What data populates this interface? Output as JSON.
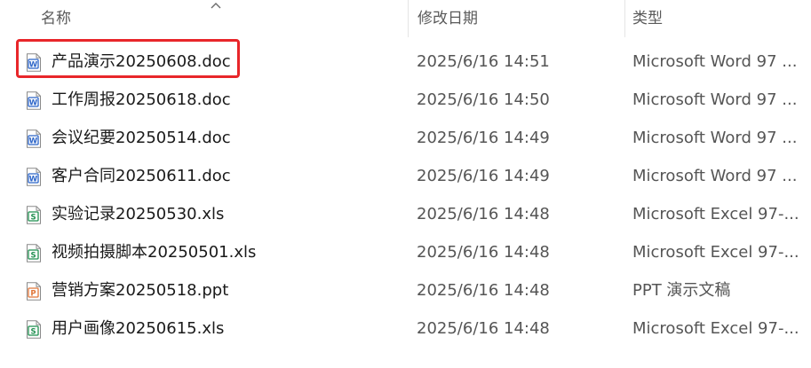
{
  "columns": {
    "name": "名称",
    "date": "修改日期",
    "type": "类型"
  },
  "files": [
    {
      "name": "产品演示20250608.doc",
      "date": "2025/6/16 14:51",
      "type": "Microsoft Word 97 ...",
      "icon": "word-doc-icon"
    },
    {
      "name": "工作周报20250618.doc",
      "date": "2025/6/16 14:50",
      "type": "Microsoft Word 97 ...",
      "icon": "word-doc-icon"
    },
    {
      "name": "会议纪要20250514.doc",
      "date": "2025/6/16 14:49",
      "type": "Microsoft Word 97 ...",
      "icon": "word-doc-icon"
    },
    {
      "name": "客户合同20250611.doc",
      "date": "2025/6/16 14:49",
      "type": "Microsoft Word 97 ...",
      "icon": "word-doc-icon"
    },
    {
      "name": "实验记录20250530.xls",
      "date": "2025/6/16 14:48",
      "type": "Microsoft Excel 97-...",
      "icon": "excel-sheet-icon"
    },
    {
      "name": "视频拍摄脚本20250501.xls",
      "date": "2025/6/16 14:48",
      "type": "Microsoft Excel 97-...",
      "icon": "excel-sheet-icon"
    },
    {
      "name": "营销方案20250518.ppt",
      "date": "2025/6/16 14:48",
      "type": "PPT 演示文稿",
      "icon": "ppt-slides-icon"
    },
    {
      "name": "用户画像20250615.xls",
      "date": "2025/6/16 14:48",
      "type": "Microsoft Excel 97-...",
      "icon": "excel-sheet-icon"
    }
  ],
  "icon_letters": {
    "word": "W",
    "excel": "S",
    "ppt": "P"
  },
  "colors": {
    "word": "#2b64c8",
    "excel": "#1f8f4f",
    "ppt": "#e1773a",
    "highlight": "#e8262a"
  }
}
